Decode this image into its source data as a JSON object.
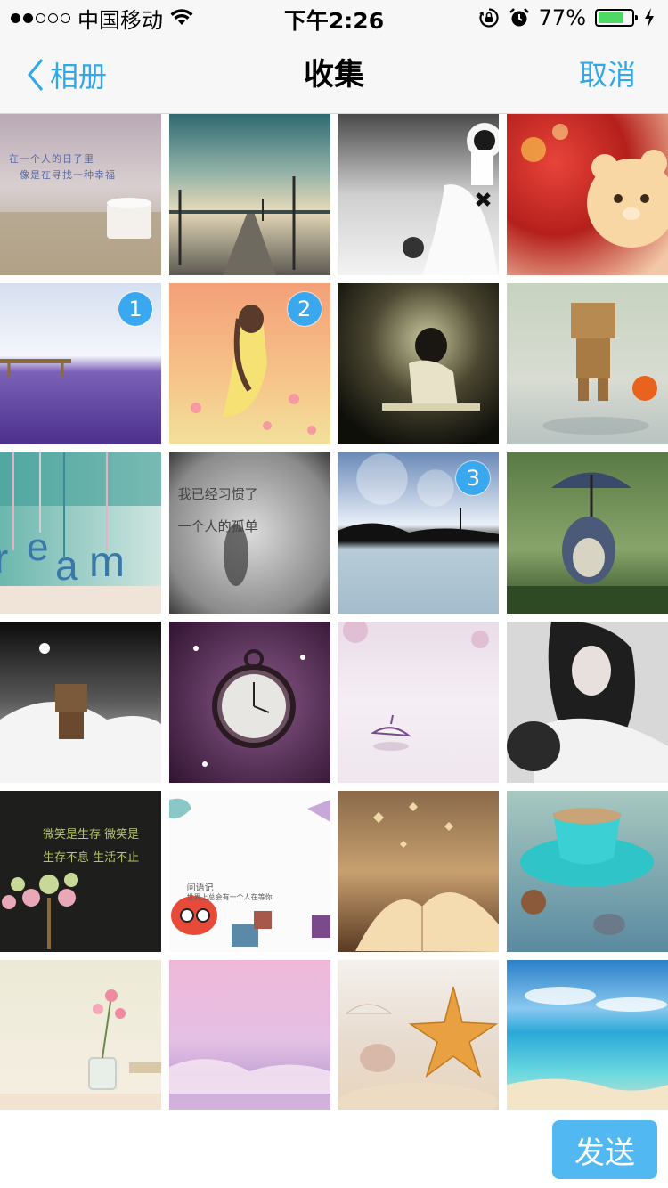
{
  "status_bar": {
    "carrier": "中国移动",
    "time": "下午2:26",
    "battery_percent": "77%",
    "battery_level": 0.77,
    "signal_bars_filled": 2,
    "signal_bars_total": 5,
    "icons": [
      "wifi-icon",
      "rotation-lock-icon",
      "alarm-icon",
      "charging-bolt-icon"
    ]
  },
  "nav": {
    "back_label": "相册",
    "title": "收集",
    "cancel_label": "取消"
  },
  "accent_color": "#2ea8e8",
  "photos": [
    {
      "id": "p1",
      "scene": "misty-field-with-cup",
      "text_line1": "在一个人的日子里",
      "text_line2": "像是在寻找一种幸福",
      "selected": null
    },
    {
      "id": "p2",
      "scene": "pier-at-dusk",
      "selected": null
    },
    {
      "id": "p3",
      "scene": "girl-in-white-dress-bw",
      "selected": null
    },
    {
      "id": "p4",
      "scene": "teddy-bear-bokeh",
      "selected": null
    },
    {
      "id": "p5",
      "scene": "lavender-field",
      "selected": "1"
    },
    {
      "id": "p6",
      "scene": "girl-in-yellow-illustration",
      "selected": "2"
    },
    {
      "id": "p7",
      "scene": "girl-by-window-dark",
      "selected": null
    },
    {
      "id": "p8",
      "scene": "cardboard-robot-with-pumpkin",
      "selected": null
    },
    {
      "id": "p9",
      "scene": "dream-letters-hanging",
      "letters": [
        "r",
        "e",
        "a",
        "m"
      ],
      "selected": null
    },
    {
      "id": "p10",
      "scene": "rainy-window-text",
      "text_line1": "我已经习惯了",
      "text_line2": "一个人的孤单",
      "selected": null
    },
    {
      "id": "p11",
      "scene": "bubbles-lake-silhouette",
      "selected": "3"
    },
    {
      "id": "p12",
      "scene": "totoro-with-umbrella",
      "selected": null
    },
    {
      "id": "p13",
      "scene": "cardboard-robot-in-snow",
      "selected": null
    },
    {
      "id": "p14",
      "scene": "pocket-watch-purple",
      "selected": null
    },
    {
      "id": "p15",
      "scene": "paper-umbrella-pink-blossoms",
      "selected": null
    },
    {
      "id": "p16",
      "scene": "woman-with-hat-bw",
      "selected": null
    },
    {
      "id": "p17",
      "scene": "chalkboard-tree",
      "text_line1": "微笑是生存  微笑是",
      "text_line2": "生存不息  生活不止",
      "selected": null
    },
    {
      "id": "p18",
      "scene": "cartoon-fox-card",
      "text_line1": "问语记",
      "text_line2": "世界上总会有一个人在等你",
      "selected": null
    },
    {
      "id": "p19",
      "scene": "open-book-butterflies",
      "selected": null
    },
    {
      "id": "p20",
      "scene": "teal-coffee-cup",
      "selected": null
    },
    {
      "id": "p21",
      "scene": "flowers-in-jar",
      "selected": null
    },
    {
      "id": "p22",
      "scene": "pink-sea-mist",
      "selected": null
    },
    {
      "id": "p23",
      "scene": "starfish-on-sand",
      "selected": null
    },
    {
      "id": "p24",
      "scene": "tropical-beach",
      "selected": null
    }
  ],
  "bottom_bar": {
    "send_label": "发送"
  }
}
